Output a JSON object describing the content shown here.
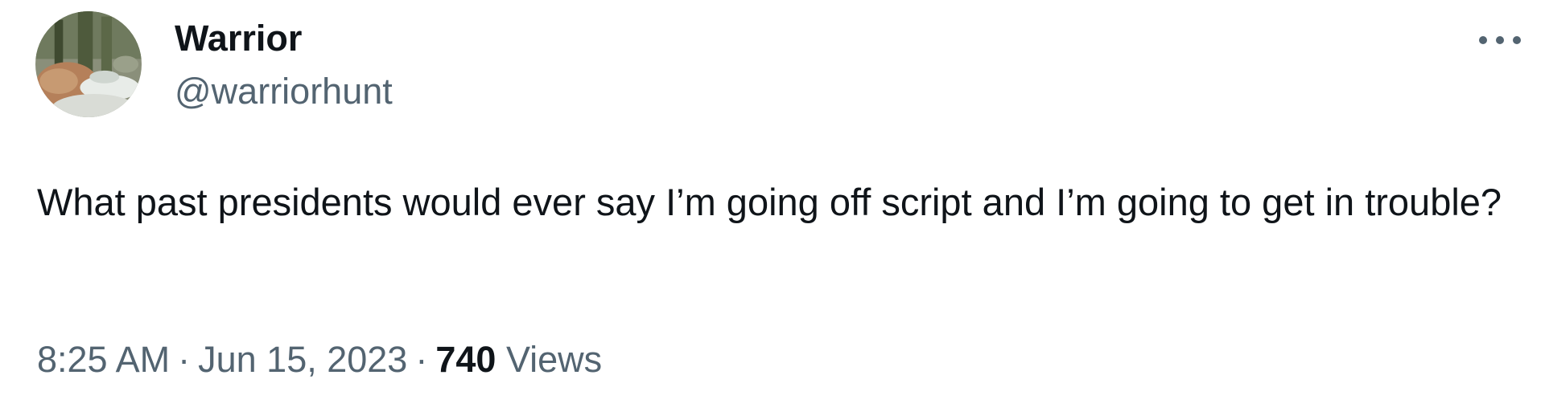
{
  "author": {
    "display_name": "Warrior",
    "handle": "@warriorhunt",
    "avatar_icon": "profile-photo-landscape"
  },
  "tweet": {
    "text": "What past presidents would ever say I’m going off script and I’m going to get in trouble?",
    "time": "8:25 AM",
    "date": "Jun 15, 2023",
    "separator": "·",
    "views_count": "740",
    "views_label": "Views"
  },
  "more_menu_icon": "ellipsis-icon",
  "colors": {
    "text_primary": "#0f1419",
    "text_secondary": "#536471",
    "background": "#ffffff"
  }
}
